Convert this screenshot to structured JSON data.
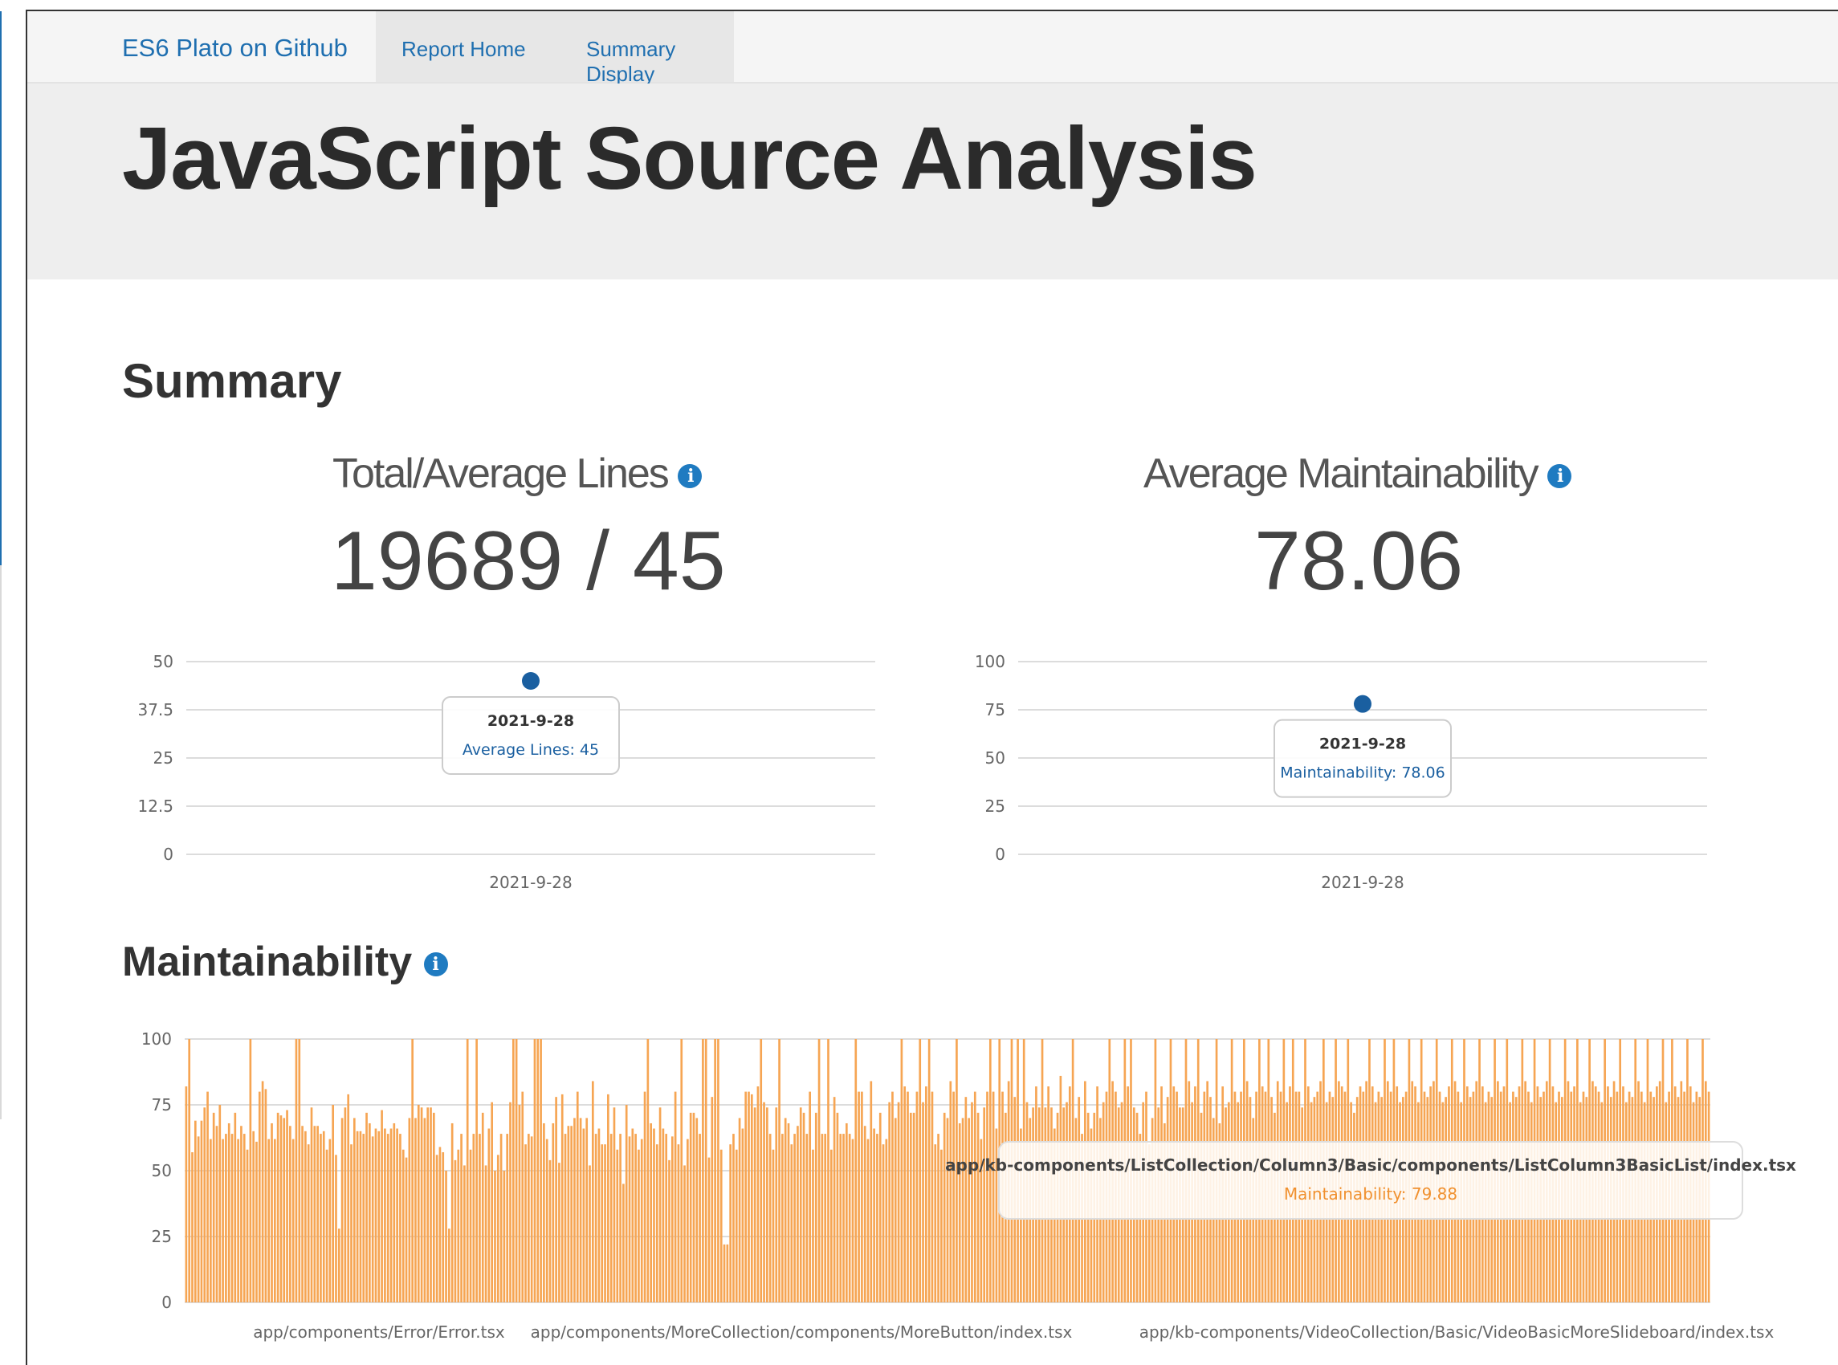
{
  "nav": {
    "brand": "ES6 Plato on Github",
    "links": [
      "Report Home",
      "Summary Display"
    ]
  },
  "hero": {
    "title": "JavaScript Source Analysis"
  },
  "summary": {
    "heading": "Summary",
    "lines": {
      "title": "Total/Average Lines",
      "value": "19689 / 45",
      "tooltip": {
        "date": "2021-9-28",
        "label": "Average Lines: 45"
      }
    },
    "maintainability": {
      "title": "Average Maintainability",
      "value": "78.06",
      "tooltip": {
        "date": "2021-9-28",
        "label": "Maintainability: 78.06"
      }
    }
  },
  "maintainability_section": {
    "heading": "Maintainability",
    "tooltip": {
      "file": "app/kb-components/ListCollection/Column3/Basic/components/ListColumn3BasicList/index.tsx",
      "label": "Maintainability: 79.88"
    }
  },
  "colors": {
    "link": "#1f6fb0",
    "point": "#1a5fa0",
    "bar": "#f6a553",
    "bar_label": "#f0902e"
  },
  "info_icon_glyph": "i",
  "chart_data": [
    {
      "type": "scatter",
      "yticks": [
        "0",
        "12.5",
        "25",
        "37.5",
        "50"
      ],
      "ylim": [
        0,
        50
      ],
      "x": [
        "2021-9-28"
      ],
      "y": [
        45
      ]
    },
    {
      "type": "scatter",
      "yticks": [
        "0",
        "25",
        "50",
        "75",
        "100"
      ],
      "ylim": [
        0,
        100
      ],
      "x": [
        "2021-9-28"
      ],
      "y": [
        78.06
      ]
    },
    {
      "type": "bar",
      "yticks": [
        "0",
        "25",
        "50",
        "75",
        "100"
      ],
      "ylim": [
        0,
        100
      ],
      "xticks": [
        "app/components/Error/Error.tsx",
        "app/components/MoreCollection/components/MoreButton/index.tsx",
        "app/kb-components/VideoCollection/Basic/VideoBasicMoreSlideboard/index.tsx"
      ],
      "values": [
        82,
        100,
        57,
        69,
        63,
        69,
        74,
        80,
        62,
        72,
        67,
        75,
        62,
        64,
        68,
        64,
        72,
        62,
        67,
        64,
        58,
        100,
        65,
        61,
        80,
        84,
        81,
        62,
        68,
        62,
        72,
        71,
        70,
        73,
        67,
        62,
        100,
        100,
        67,
        65,
        60,
        74,
        67,
        67,
        64,
        65,
        58,
        62,
        75,
        56,
        28,
        70,
        74,
        79,
        60,
        70,
        65,
        65,
        64,
        72,
        68,
        63,
        66,
        65,
        73,
        66,
        64,
        66,
        68,
        66,
        64,
        58,
        55,
        70,
        100,
        70,
        75,
        74,
        70,
        74,
        74,
        72,
        56,
        59,
        57,
        50,
        28,
        68,
        54,
        58,
        64,
        52,
        100,
        58,
        64,
        100,
        64,
        72,
        52,
        66,
        76,
        50,
        56,
        64,
        50,
        64,
        76,
        100,
        100,
        75,
        80,
        60,
        64,
        63,
        100,
        100,
        100,
        68,
        62,
        54,
        68,
        78,
        53,
        79,
        64,
        67,
        67,
        70,
        80,
        70,
        66,
        70,
        52,
        84,
        64,
        66,
        60,
        60,
        79,
        64,
        74,
        58,
        64,
        45,
        75,
        63,
        66,
        64,
        58,
        62,
        80,
        100,
        68,
        66,
        60,
        74,
        66,
        64,
        54,
        63,
        80,
        60,
        100,
        52,
        62,
        72,
        72,
        70,
        64,
        100,
        100,
        55,
        78,
        100,
        100,
        58,
        22,
        22,
        60,
        64,
        58,
        70,
        66,
        80,
        80,
        79,
        74,
        82,
        100,
        76,
        74,
        64,
        58,
        74,
        100,
        64,
        70,
        68,
        60,
        64,
        67,
        74,
        72,
        64,
        80,
        58,
        72,
        100,
        64,
        64,
        100,
        58,
        78,
        72,
        64,
        64,
        68,
        64,
        62,
        100,
        80,
        80,
        67,
        62,
        84,
        66,
        64,
        72,
        60,
        62,
        76,
        80,
        70,
        76,
        100,
        82,
        80,
        72,
        72,
        80,
        100,
        76,
        82,
        100,
        80,
        60,
        64,
        58,
        72,
        70,
        84,
        80,
        100,
        68,
        70,
        78,
        70,
        76,
        80,
        72,
        62,
        74,
        80,
        100,
        80,
        66,
        100,
        80,
        72,
        84,
        100,
        78,
        100,
        66,
        100,
        76,
        70,
        74,
        82,
        74,
        100,
        74,
        82,
        74,
        66,
        72,
        86,
        74,
        76,
        82,
        100,
        70,
        78,
        64,
        84,
        72,
        66,
        72,
        82,
        70,
        76,
        80,
        100,
        84,
        80,
        74,
        76,
        100,
        82,
        100,
        74,
        72,
        64,
        76,
        80,
        60,
        70,
        100,
        74,
        82,
        68,
        78,
        100,
        82,
        80,
        74,
        74,
        100,
        84,
        76,
        82,
        100,
        72,
        80,
        84,
        78,
        70,
        100,
        68,
        82,
        74,
        76,
        100,
        80,
        76,
        80,
        100,
        84,
        78,
        70,
        80,
        100,
        82,
        80,
        100,
        78,
        72,
        84,
        80,
        100,
        76,
        82,
        100,
        80,
        80,
        74,
        100,
        82,
        76,
        78,
        80,
        84,
        100,
        76,
        80,
        78,
        100,
        84,
        82,
        80,
        100,
        76,
        72,
        78,
        82,
        80,
        84,
        100,
        82,
        76,
        80,
        78,
        100,
        84,
        80,
        100,
        82,
        76,
        78,
        80,
        100,
        84,
        82,
        76,
        100,
        80,
        78,
        82,
        84,
        100,
        80,
        76,
        78,
        82,
        100,
        84,
        80,
        76,
        100,
        82,
        78,
        80,
        84,
        100,
        82,
        76,
        80,
        78,
        100,
        84,
        80,
        82,
        100,
        76,
        80,
        78,
        82,
        100,
        84,
        80,
        76,
        100,
        82,
        78,
        80,
        84,
        100,
        82,
        76,
        80,
        78,
        100,
        84,
        80,
        82,
        100,
        76,
        80,
        78,
        100,
        84,
        82,
        80,
        76,
        100,
        82,
        78,
        84,
        80,
        100,
        82,
        76,
        80,
        78,
        100,
        84,
        80,
        76,
        100,
        80,
        78,
        82,
        84,
        100,
        76,
        80,
        100,
        82,
        78,
        84,
        80,
        100,
        82,
        76,
        80,
        78,
        100,
        84,
        80
      ]
    }
  ]
}
